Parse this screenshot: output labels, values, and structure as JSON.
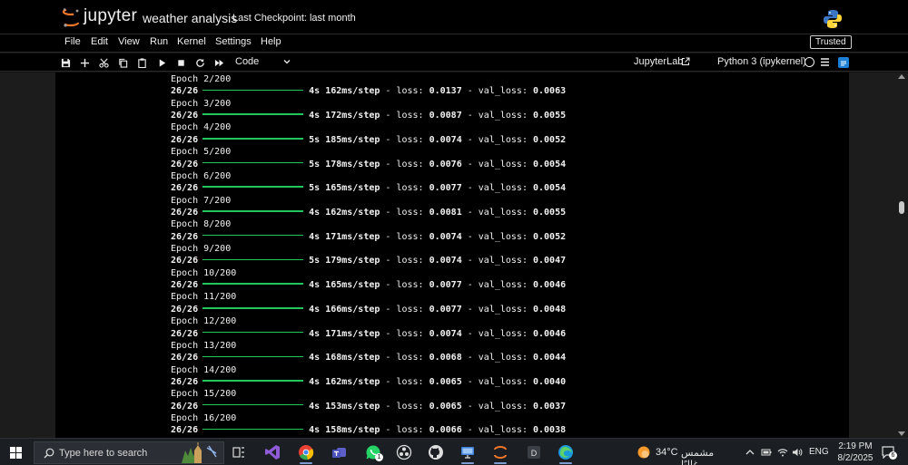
{
  "header": {
    "brand": "jupyter",
    "notebook_title": "weather analysis",
    "checkpoint": "Last Checkpoint: last month"
  },
  "menubar": {
    "items": [
      "File",
      "Edit",
      "View",
      "Run",
      "Kernel",
      "Settings",
      "Help"
    ],
    "trusted": "Trusted"
  },
  "toolbar": {
    "cell_type": "Code",
    "jupyterlab": "JupyterLab",
    "kernel": "Python 3 (ipykernel)",
    "icons": [
      "save-icon",
      "add-cell-icon",
      "cut-icon",
      "copy-icon",
      "paste-icon",
      "run-icon",
      "stop-icon",
      "restart-icon",
      "fast-forward-icon",
      "chevron-down-icon",
      "external-link-icon",
      "kernel-idle-icon",
      "menu-icon",
      "command-palette-icon"
    ]
  },
  "output": {
    "epochs": [
      {
        "epoch": "Epoch 2/200",
        "steps": "26/26",
        "time": "4s",
        "ms": "162ms/step",
        "loss": "0.0137",
        "val_loss": "0.0063"
      },
      {
        "epoch": "Epoch 3/200",
        "steps": "26/26",
        "time": "4s",
        "ms": "172ms/step",
        "loss": "0.0087",
        "val_loss": "0.0055"
      },
      {
        "epoch": "Epoch 4/200",
        "steps": "26/26",
        "time": "5s",
        "ms": "185ms/step",
        "loss": "0.0074",
        "val_loss": "0.0052"
      },
      {
        "epoch": "Epoch 5/200",
        "steps": "26/26",
        "time": "5s",
        "ms": "178ms/step",
        "loss": "0.0076",
        "val_loss": "0.0054"
      },
      {
        "epoch": "Epoch 6/200",
        "steps": "26/26",
        "time": "5s",
        "ms": "165ms/step",
        "loss": "0.0077",
        "val_loss": "0.0054"
      },
      {
        "epoch": "Epoch 7/200",
        "steps": "26/26",
        "time": "4s",
        "ms": "162ms/step",
        "loss": "0.0081",
        "val_loss": "0.0055"
      },
      {
        "epoch": "Epoch 8/200",
        "steps": "26/26",
        "time": "4s",
        "ms": "171ms/step",
        "loss": "0.0074",
        "val_loss": "0.0052"
      },
      {
        "epoch": "Epoch 9/200",
        "steps": "26/26",
        "time": "5s",
        "ms": "179ms/step",
        "loss": "0.0074",
        "val_loss": "0.0047"
      },
      {
        "epoch": "Epoch 10/200",
        "steps": "26/26",
        "time": "4s",
        "ms": "165ms/step",
        "loss": "0.0077",
        "val_loss": "0.0046"
      },
      {
        "epoch": "Epoch 11/200",
        "steps": "26/26",
        "time": "4s",
        "ms": "166ms/step",
        "loss": "0.0077",
        "val_loss": "0.0048"
      },
      {
        "epoch": "Epoch 12/200",
        "steps": "26/26",
        "time": "4s",
        "ms": "171ms/step",
        "loss": "0.0074",
        "val_loss": "0.0046"
      },
      {
        "epoch": "Epoch 13/200",
        "steps": "26/26",
        "time": "4s",
        "ms": "168ms/step",
        "loss": "0.0068",
        "val_loss": "0.0044"
      },
      {
        "epoch": "Epoch 14/200",
        "steps": "26/26",
        "time": "4s",
        "ms": "162ms/step",
        "loss": "0.0065",
        "val_loss": "0.0040"
      },
      {
        "epoch": "Epoch 15/200",
        "steps": "26/26",
        "time": "4s",
        "ms": "153ms/step",
        "loss": "0.0065",
        "val_loss": "0.0037"
      },
      {
        "epoch": "Epoch 16/200",
        "steps": "26/26",
        "time": "4s",
        "ms": "158ms/step",
        "loss": "0.0066",
        "val_loss": "0.0038"
      }
    ],
    "progress_fraction": 1.0,
    "progress_color": "#23c55e"
  },
  "taskbar": {
    "search_placeholder": "Type here to search",
    "apps": [
      "start-icon",
      "task-view-icon",
      "visual-studio-icon",
      "chrome-icon",
      "teams-icon",
      "whatsapp-icon",
      "obs-icon",
      "github-icon",
      "remote-desktop-icon",
      "jupyter-taskbar-icon",
      "app-d-icon",
      "edge-icon"
    ],
    "whatsapp_badge": "1",
    "temperature": "34°C",
    "weather_desc": "مشمس غالبًا",
    "language": "ENG",
    "time": "2:19 PM",
    "date": "8/2/2025",
    "notification_count": "6"
  }
}
